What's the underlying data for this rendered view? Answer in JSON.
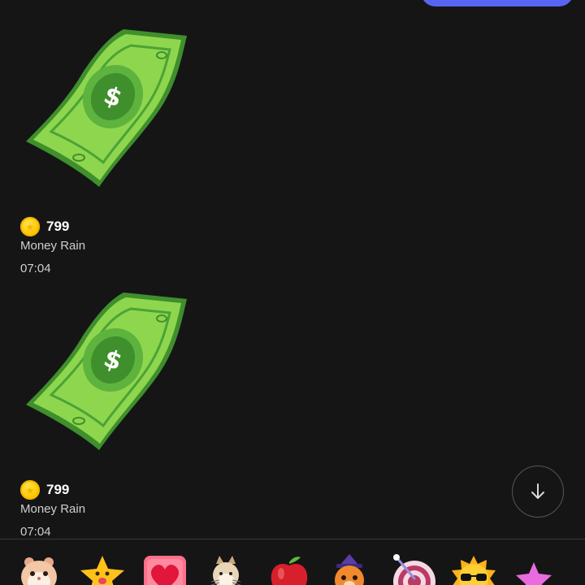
{
  "messages": [
    {
      "gift_icon": "money-bill-icon",
      "coin_icon": "coin-icon",
      "price": "799",
      "gift_name": "Money Rain",
      "time": "07:04"
    },
    {
      "gift_icon": "money-bill-icon",
      "coin_icon": "coin-icon",
      "price": "799",
      "gift_name": "Money Rain",
      "time": "07:04"
    }
  ],
  "gift_bar": {
    "items": [
      "hamster-icon",
      "star-face-icon",
      "heart-box-icon",
      "cat-icon",
      "apple-icon",
      "cat-wizard-icon",
      "dartboard-icon",
      "sun-sunglasses-icon",
      "pink-star-icon"
    ]
  },
  "scroll_button": {
    "icon": "arrow-down-icon"
  },
  "colors": {
    "background": "#151516",
    "accent": "#5865f2",
    "bill_green": "#8fd64f",
    "coin": "#ffd21f"
  }
}
